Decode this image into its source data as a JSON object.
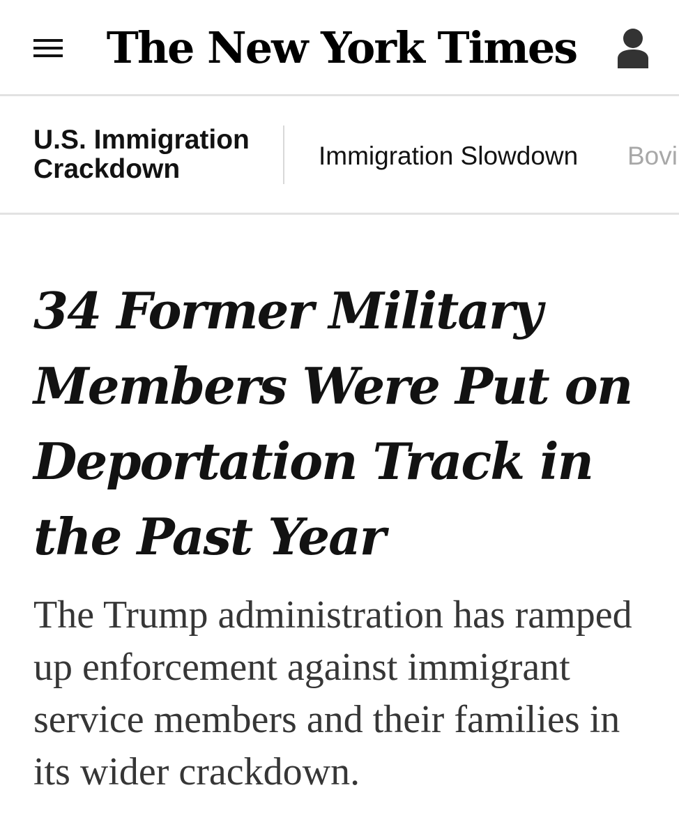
{
  "masthead": {
    "logo_text": "The New York Times",
    "menu_icon": "hamburger-menu-icon",
    "account_icon": "user-account-icon"
  },
  "section_nav": {
    "section_title": "U.S. Immigration Crackdown",
    "links": [
      {
        "label": "Immigration Slowdown"
      },
      {
        "label": "Bovi"
      }
    ]
  },
  "article": {
    "headline": "34 Former Military Members Were Put on Deportation Track in the Past Year",
    "summary": "The Trump administration has ramped up enforcement against immigrant service members and their families in its wider crackdown."
  },
  "colors": {
    "text": "#121212",
    "summary_text": "#363636",
    "faded_link": "#a8a8a8",
    "divider": "#e2e2e2"
  }
}
